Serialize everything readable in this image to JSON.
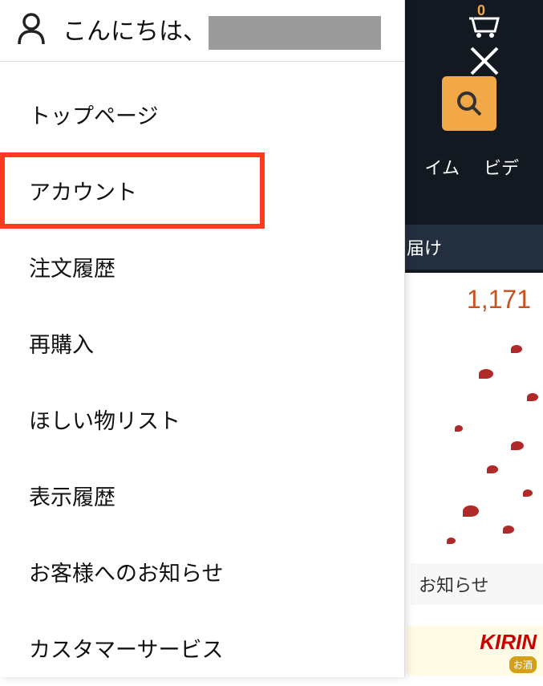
{
  "header": {
    "greeting": "こんにちは、"
  },
  "menu": {
    "items": [
      {
        "label": "トップページ",
        "highlighted": false
      },
      {
        "label": "アカウント",
        "highlighted": true
      },
      {
        "label": "注文履歴",
        "highlighted": false
      },
      {
        "label": "再購入",
        "highlighted": false
      },
      {
        "label": "ほしい物リスト",
        "highlighted": false
      },
      {
        "label": "表示履歴",
        "highlighted": false
      },
      {
        "label": "お客様へのお知らせ",
        "highlighted": false
      },
      {
        "label": "カスタマーサービス",
        "highlighted": false
      }
    ]
  },
  "background": {
    "cart_count": "0",
    "nav_item_1": "イム",
    "nav_item_2": "ビデ",
    "delivery_text": "届け",
    "price_text": "1,171",
    "notice_text": "お知らせ",
    "kirin_text": "KIRIN",
    "kirin_badge": "お酒"
  }
}
